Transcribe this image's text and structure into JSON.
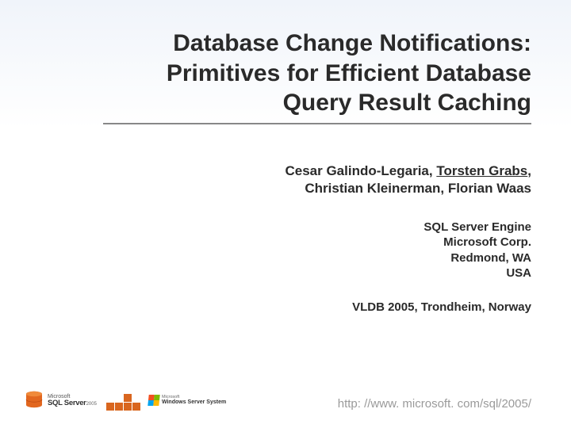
{
  "title": "Database Change Notifications: Primitives for Efficient Database Query Result Caching",
  "authors": {
    "line1_before": "Cesar Galindo-Legaria, ",
    "line1_underlined": "Torsten Grabs",
    "line1_after": ",",
    "line2": "Christian Kleinerman, Florian Waas"
  },
  "affiliation": {
    "line1": "SQL Server Engine",
    "line2": "Microsoft Corp.",
    "line3": "Redmond, WA",
    "line4": "USA"
  },
  "venue": "VLDB 2005, Trondheim, Norway",
  "url": "http: //www. microsoft. com/sql/2005/",
  "logo": {
    "sql_ms": "Microsoft",
    "sql_prod": "SQL Server",
    "sql_year": "2005",
    "ws_l1": "Microsoft",
    "ws_l2": "Windows Server System"
  }
}
